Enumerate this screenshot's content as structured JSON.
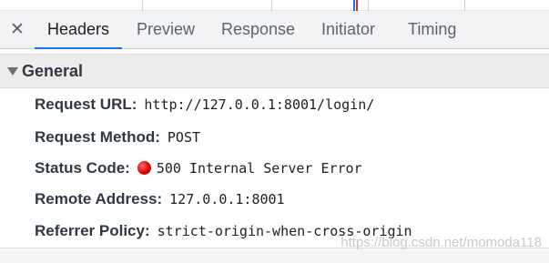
{
  "tabs": {
    "close_icon": "close-icon",
    "items": [
      {
        "label": "Headers",
        "active": true
      },
      {
        "label": "Preview",
        "active": false
      },
      {
        "label": "Response",
        "active": false
      },
      {
        "label": "Initiator",
        "active": false
      },
      {
        "label": "Timing",
        "active": false
      }
    ],
    "active_color": "#1a73e8"
  },
  "general": {
    "title": "General",
    "expanded": true,
    "rows": [
      {
        "label": "Request URL:",
        "value": "http://127.0.0.1:8001/login/"
      },
      {
        "label": "Request Method:",
        "value": "POST"
      },
      {
        "label": "Status Code:",
        "value": "500 Internal Server Error",
        "status_color": "#e00000"
      },
      {
        "label": "Remote Address:",
        "value": "127.0.0.1:8001"
      },
      {
        "label": "Referrer Policy:",
        "value": "strict-origin-when-cross-origin"
      }
    ]
  },
  "watermark": "https://blog.csdn.net/momoda118"
}
